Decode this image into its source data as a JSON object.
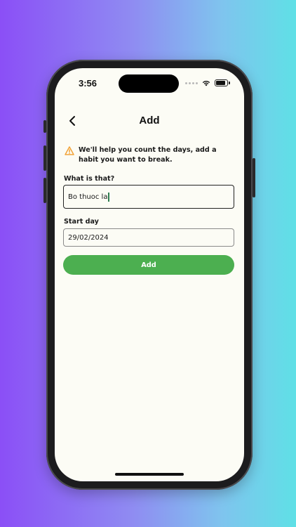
{
  "status_bar": {
    "time": "3:56"
  },
  "header": {
    "title": "Add",
    "back_icon": "chevron-left-icon"
  },
  "notice": {
    "icon": "warning-icon",
    "icon_color": "#f2a43a",
    "text": "We'll help you count the days, add a habit you want to break."
  },
  "form": {
    "habit_label": "What is that?",
    "habit_value": "Bo thuoc la",
    "start_label": "Start day",
    "start_value": "29/02/2024",
    "submit_label": "Add"
  },
  "colors": {
    "accent": "#4caf50",
    "background": "#fcfcf5"
  }
}
